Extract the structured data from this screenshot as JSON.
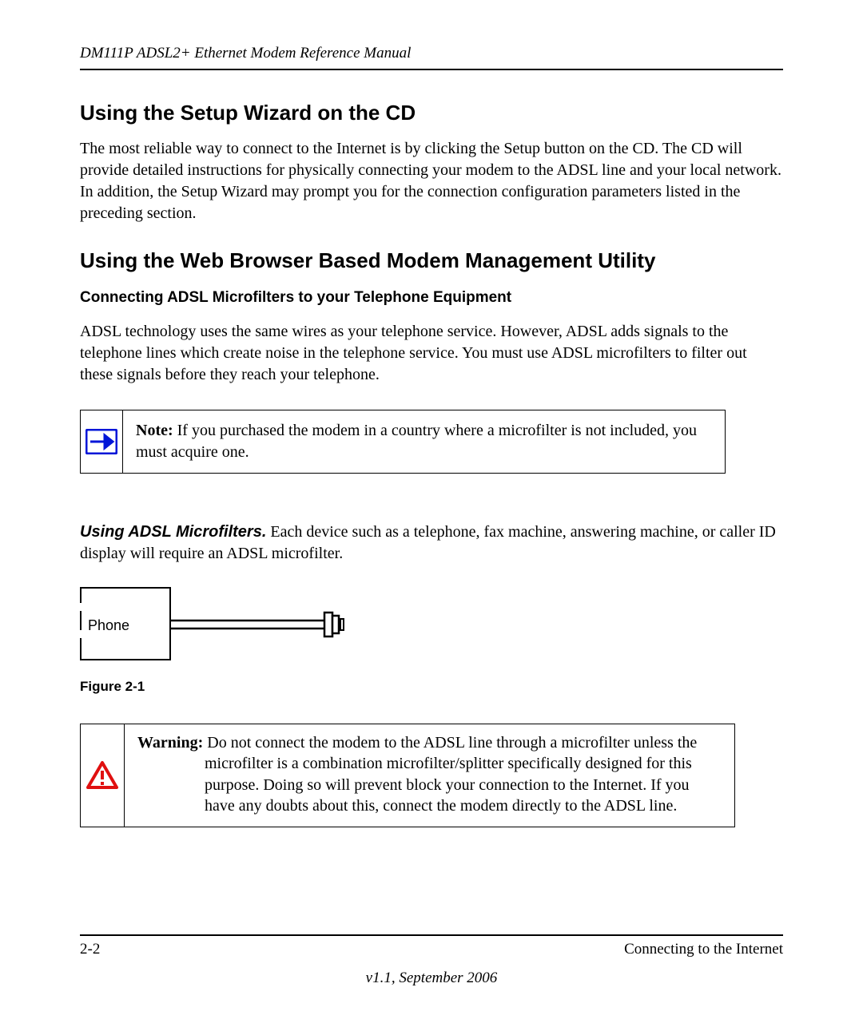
{
  "header": {
    "doc_title": "DM111P ADSL2+ Ethernet Modem Reference Manual"
  },
  "section1": {
    "heading": "Using the Setup Wizard on the CD",
    "body": "The most reliable way to connect to the Internet is by clicking the Setup button on the CD. The CD will provide detailed instructions for physically connecting your modem to the ADSL line and your local network. In addition, the Setup Wizard may prompt you for the connection configuration parameters listed in the preceding section."
  },
  "section2": {
    "heading": "Using the Web Browser Based Modem Management Utility",
    "subheading": "Connecting ADSL Microfilters to your Telephone Equipment",
    "body": "ADSL technology uses the same wires as your telephone service. However, ADSL adds signals to the telephone lines which create noise in the telephone service. You must use ADSL microfilters to filter out these signals before they reach your telephone."
  },
  "note": {
    "label": "Note:",
    "text": " If you purchased the modem in a country where a microfilter is not included, you must acquire one."
  },
  "runin": {
    "heading": "Using ADSL Microfilters.",
    "text": " Each device such as a telephone, fax machine, answering machine, or caller ID display will require an ADSL microfilter."
  },
  "figure": {
    "phone_label": "Phone",
    "caption": "Figure 2-1"
  },
  "warning": {
    "label": "Warning:",
    "text": " Do not connect the modem to the ADSL line through a microfilter unless the microfilter is a combination microfilter/splitter specifically designed for this purpose. Doing so will prevent block your connection to the Internet. If you have any doubts about this, connect the modem directly to the ADSL line."
  },
  "footer": {
    "page": "2-2",
    "chapter": "Connecting to the Internet",
    "version": "v1.1, September 2006"
  }
}
